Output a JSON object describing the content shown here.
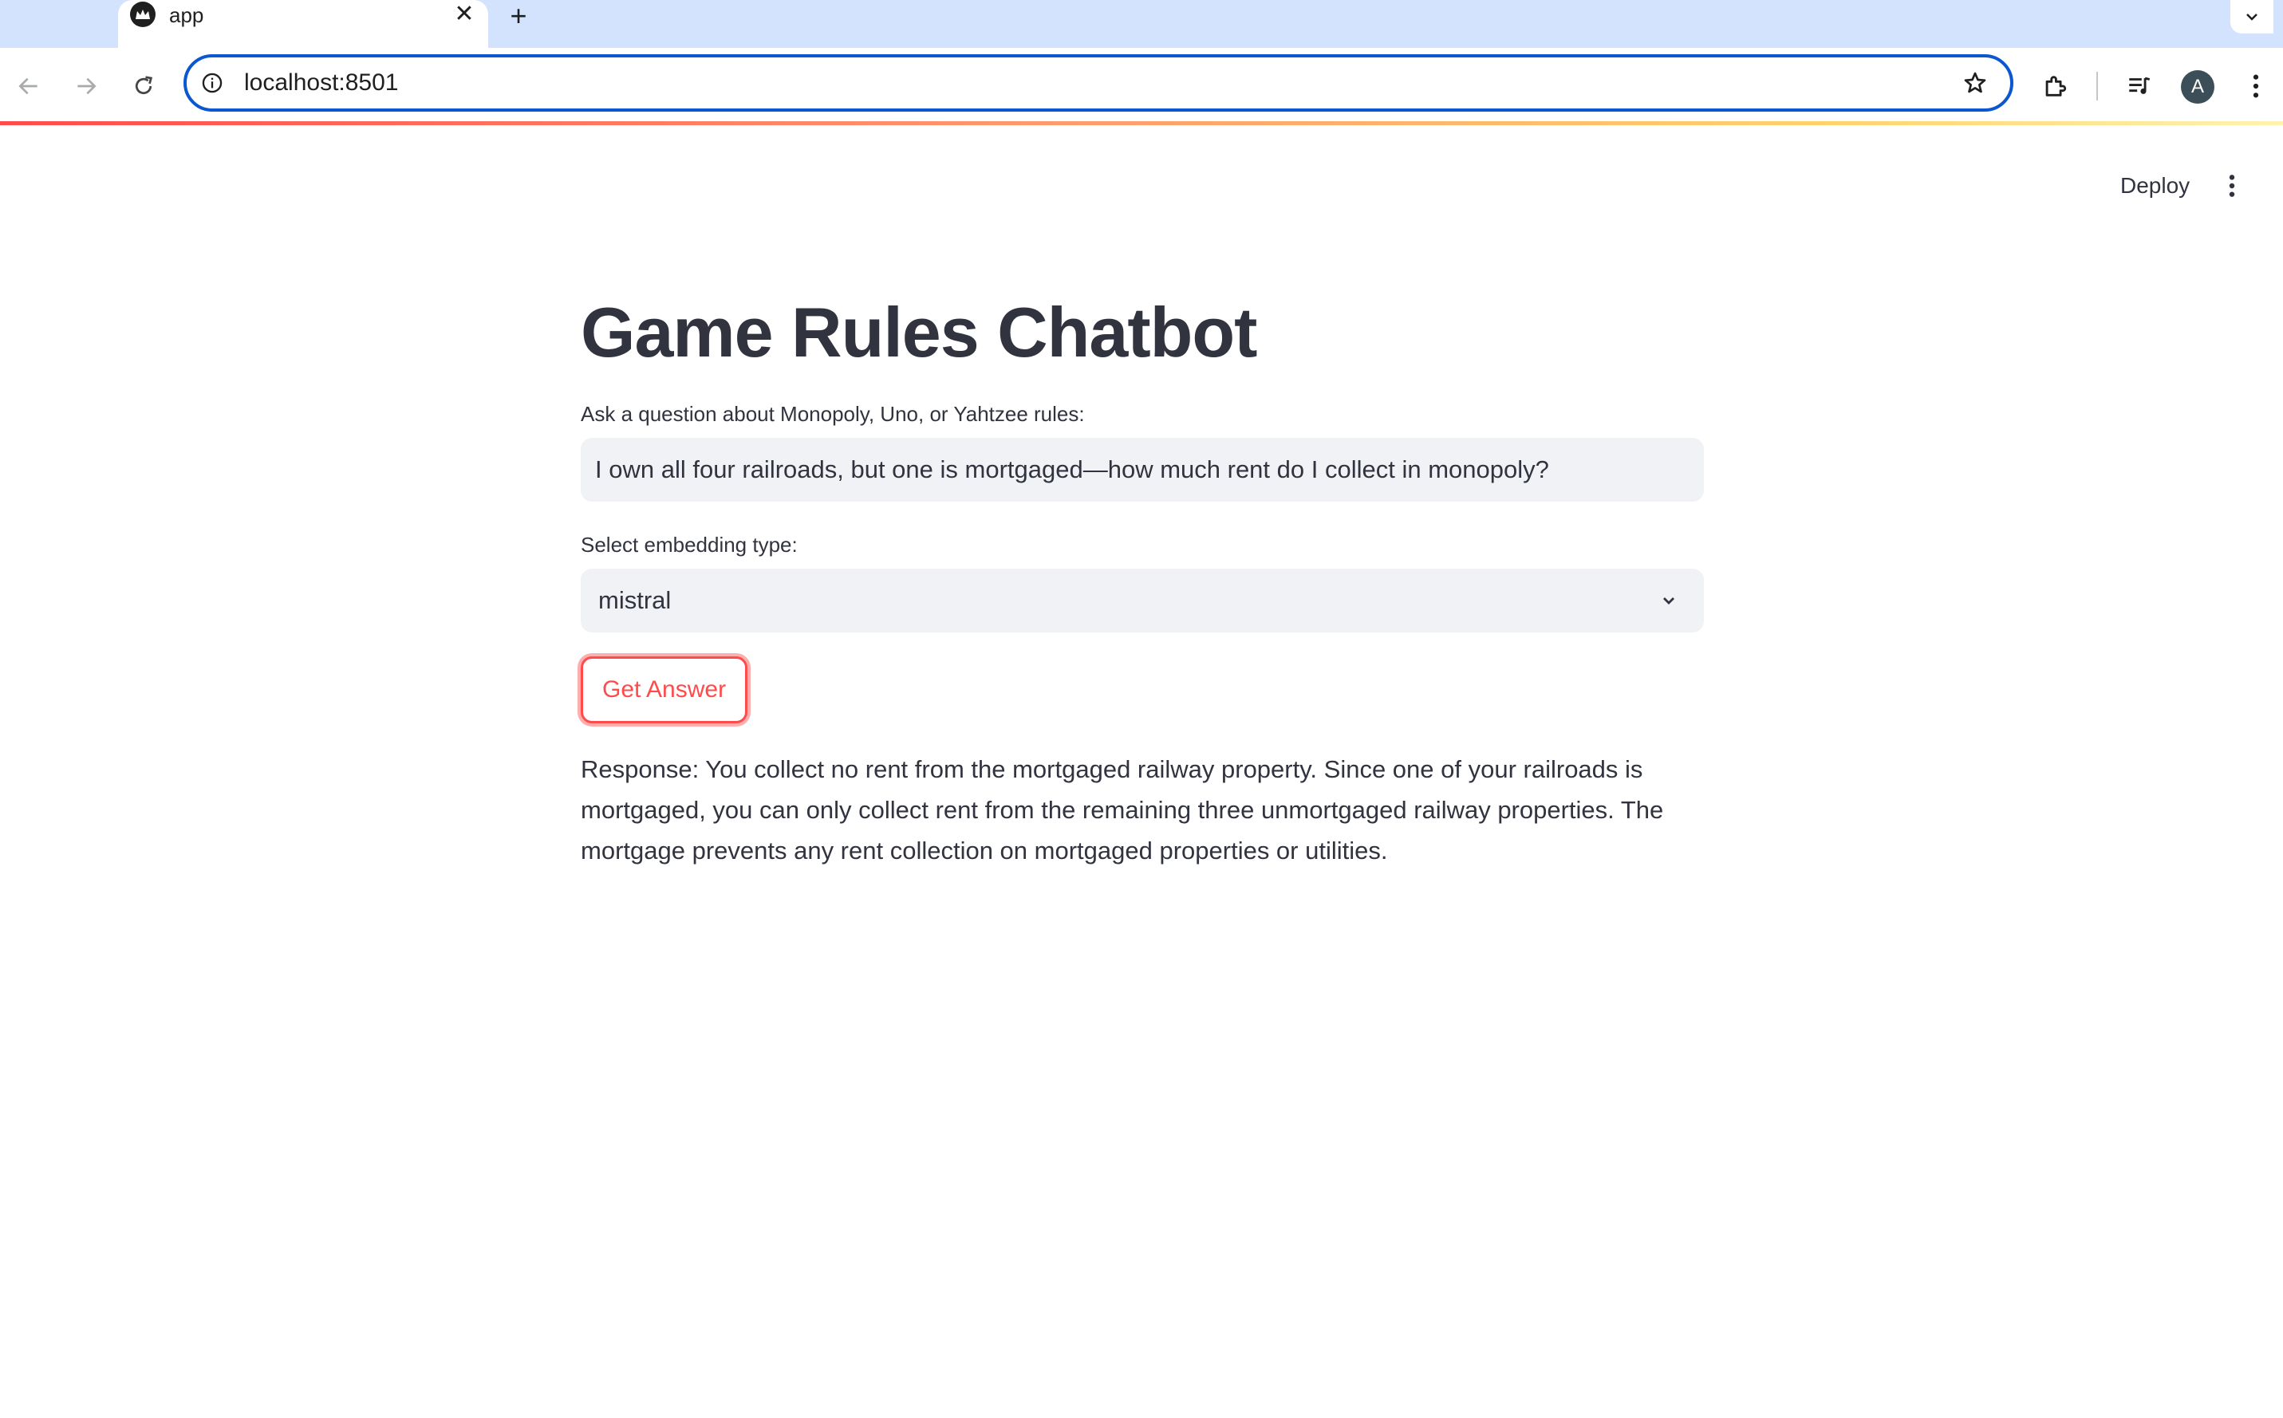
{
  "browser": {
    "tab": {
      "title": "app",
      "close_glyph": "✕"
    },
    "new_tab_glyph": "+",
    "address": {
      "url": "localhost:8501"
    },
    "profile_initial": "A",
    "icons": {
      "favicon": "streamlit-crown-icon",
      "back": "back-arrow-icon",
      "forward": "forward-arrow-icon",
      "reload": "reload-icon",
      "site_info": "info-icon",
      "bookmark": "star-icon",
      "extensions": "puzzle-icon",
      "media": "media-control-icon",
      "menu": "kebab-menu-icon",
      "tab_list": "chevron-down-icon"
    }
  },
  "app_header": {
    "deploy_label": "Deploy",
    "menu_icon": "vertical-dots-icon"
  },
  "main": {
    "title": "Game Rules Chatbot",
    "question_label": "Ask a question about Monopoly, Uno, or Yahtzee rules:",
    "question_value": "I own all four railroads, but one is mortgaged—how much rent do I collect in monopoly?",
    "embedding_label": "Select embedding type:",
    "embedding_selected": "mistral",
    "button_label": "Get Answer",
    "response": "Response: You collect no rent from the mortgaged railway property. Since one of your railroads is mortgaged, you can only collect rent from the remaining three unmortgaged railway properties. The mortgage prevents any rent collection on mortgaged properties or utilities."
  },
  "colors": {
    "primary": "#ff4b4b",
    "text": "#31333f",
    "input_bg": "#f0f2f6",
    "chrome_tabstrip": "#d3e3fd",
    "omnibox_focus": "#0b57d0"
  }
}
